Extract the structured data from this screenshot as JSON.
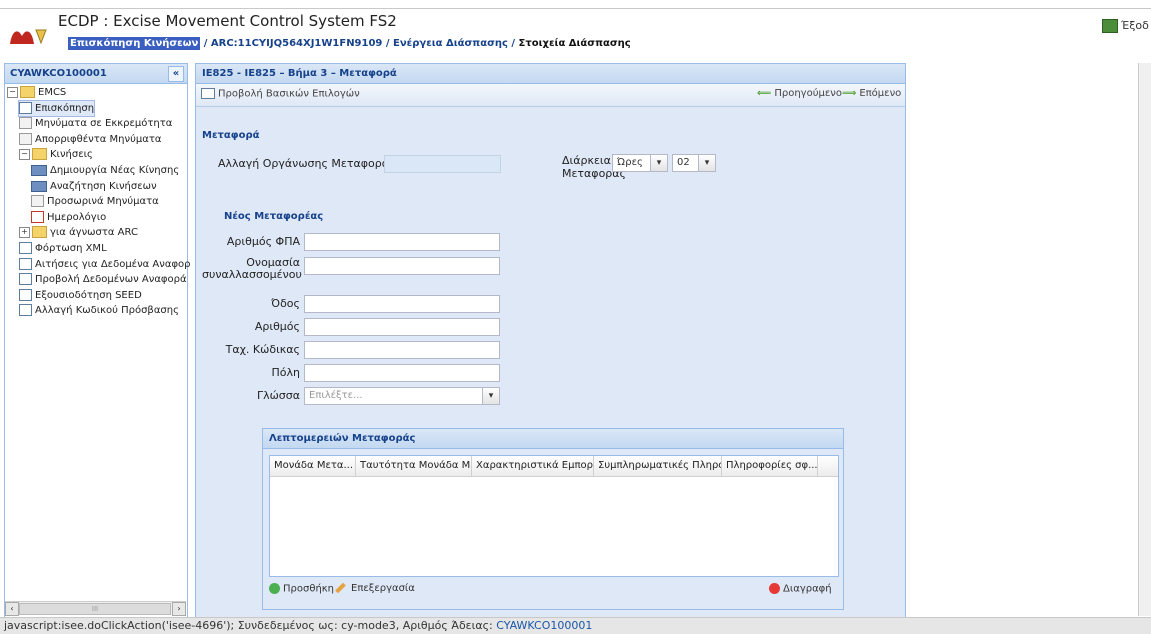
{
  "header": {
    "title": "ECDP : Excise Movement Control System FS2",
    "exit_label": "Έξοδ",
    "breadcrumb": {
      "item1": "Επισκόπηση Κινήσεων",
      "sep1": " / ",
      "item2": "ARC:11CYIJQ564XJ1W1FN9109",
      "sep2": " / ",
      "item3": "Ενέργεια Διάσπασης",
      "sep3": " / ",
      "item4": "Στοιχεία Διάσπασης"
    }
  },
  "sidebar": {
    "title": "CYAWKCO100001",
    "collapse_glyph": "«",
    "items": [
      {
        "label": "EMCS",
        "type": "folder",
        "expander": "−"
      },
      {
        "label": "Επισκόπηση",
        "type": "list",
        "selected": true
      },
      {
        "label": "Μηνύματα σε Εκκρεμότητα",
        "type": "doc"
      },
      {
        "label": "Απορριφθέντα Μηνύματα",
        "type": "doc"
      },
      {
        "label": "Κινήσεις",
        "type": "folder",
        "expander": "−"
      },
      {
        "label": "Δημιουργία Νέας Κίνησης",
        "type": "truck"
      },
      {
        "label": "Αναζήτηση Κινήσεων",
        "type": "truck"
      },
      {
        "label": "Προσωρινά Μηνύματα",
        "type": "doc"
      },
      {
        "label": "Ημερολόγιο",
        "type": "cal"
      },
      {
        "label": "για άγνωστα ARC",
        "type": "folder",
        "expander": "+"
      },
      {
        "label": "Φόρτωση XML",
        "type": "list"
      },
      {
        "label": "Αιτήσεις για Δεδομένα Αναφορ",
        "type": "list"
      },
      {
        "label": "Προβολή Δεδομένων Αναφορά",
        "type": "list"
      },
      {
        "label": "Εξουσιοδότηση SEED",
        "type": "list"
      },
      {
        "label": "Αλλαγή Κωδικού Πρόσβασης",
        "type": "list"
      }
    ],
    "scroll_left": "‹",
    "scroll_right": "›",
    "scroll_thumb": "III"
  },
  "panel": {
    "title": "IE825 - IE825 – Βήμα 3 – Μεταφορά",
    "toolbar": {
      "basic_options": "Προβολή Βασικών Επιλογών",
      "previous": "Προηγούμενο",
      "next": "Επόμενο"
    },
    "section_title": "Μεταφορά",
    "change_org_label": "Αλλαγή Οργάνωσης Μεταφοράς",
    "duration_label_1": "Διάρκεια",
    "duration_label_2": "Μεταφοράς",
    "duration_unit": "Ώρες",
    "duration_value": "02",
    "new_carrier_title": "Νέος Μεταφορέας",
    "vat_label": "Αριθμός ΦΠΑ",
    "name_label_1": "Ονομασία",
    "name_label_2": "συναλλασσομένου",
    "street_label": "Όδος",
    "number_label": "Αριθμός",
    "postcode_label": "Ταχ. Κώδικας",
    "city_label": "Πόλη",
    "language_label": "Γλώσσα",
    "language_placeholder": "Επιλέξτε..."
  },
  "details": {
    "title": "Λεπτομερειών Μεταφοράς",
    "columns": [
      "Μονάδα Μετα...",
      "Ταυτότητα Μονάδα Με...",
      "Χαρακτηριστικά Εμπορικ...",
      "Συμπληρωματικές Πληροφ...",
      "Πληροφορίες σφ..."
    ],
    "add_label": "Προσθήκη",
    "edit_label": "Επεξεργασία",
    "delete_label": "Διαγραφή"
  },
  "status": {
    "prefix": "javascript:isee.doClickAction('isee-4696'); Συνδεδεμένος ως: cy-mode3, Αριθμός Άδειας: ",
    "licence": "CYAWKCO100001"
  },
  "glyphs": {
    "dropdown": "▾",
    "arrow_left": "⟸",
    "arrow_right": "⟹"
  }
}
